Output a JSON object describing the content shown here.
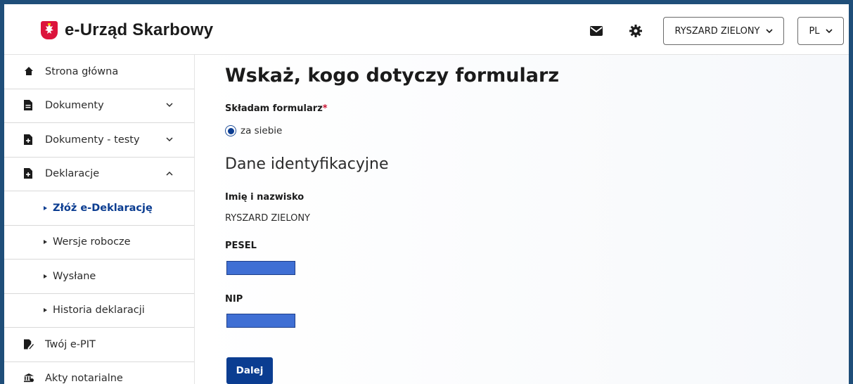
{
  "header": {
    "app_title": "e-Urząd Skarbowy",
    "user_label": "RYSZARD ZIELONY",
    "lang_label": "PL",
    "icons": [
      "polish-emblem-icon",
      "mail-icon",
      "gear-icon",
      "chevron-down-icon"
    ]
  },
  "sidebar": {
    "items": [
      {
        "label": "Strona główna",
        "icon": "home-icon"
      },
      {
        "label": "Dokumenty",
        "icon": "document-icon",
        "expanded": false
      },
      {
        "label": "Dokumenty - testy",
        "icon": "document-plus-icon",
        "expanded": false
      },
      {
        "label": "Deklaracje",
        "icon": "document-plus-icon",
        "expanded": true
      },
      {
        "label": "Twój e-PIT",
        "icon": "document-pen-icon"
      },
      {
        "label": "Akty notarialne",
        "icon": "bank-icon"
      }
    ],
    "subitems": [
      {
        "label": "Złóż e-Deklarację",
        "active": true
      },
      {
        "label": "Wersje robocze",
        "active": false
      },
      {
        "label": "Wysłane",
        "active": false
      },
      {
        "label": "Historia deklaracji",
        "active": false
      }
    ]
  },
  "main": {
    "title": "Wskaż, kogo dotyczy formularz",
    "form_label": "Składam formularz",
    "required_mark": "*",
    "radio_option": "za siebie",
    "radio_selected": true,
    "section_title": "Dane identyfikacyjne",
    "name_label": "Imię i nazwisko",
    "name_value": "RYSZARD ZIELONY",
    "pesel_label": "PESEL",
    "nip_label": "NIP",
    "next_button": "Dalej"
  },
  "colors": {
    "frame": "#1f4e79",
    "primary": "#0b3d91",
    "required": "#c8102e",
    "redaction": "#3f6fd4",
    "emblem": "#dc143c"
  }
}
